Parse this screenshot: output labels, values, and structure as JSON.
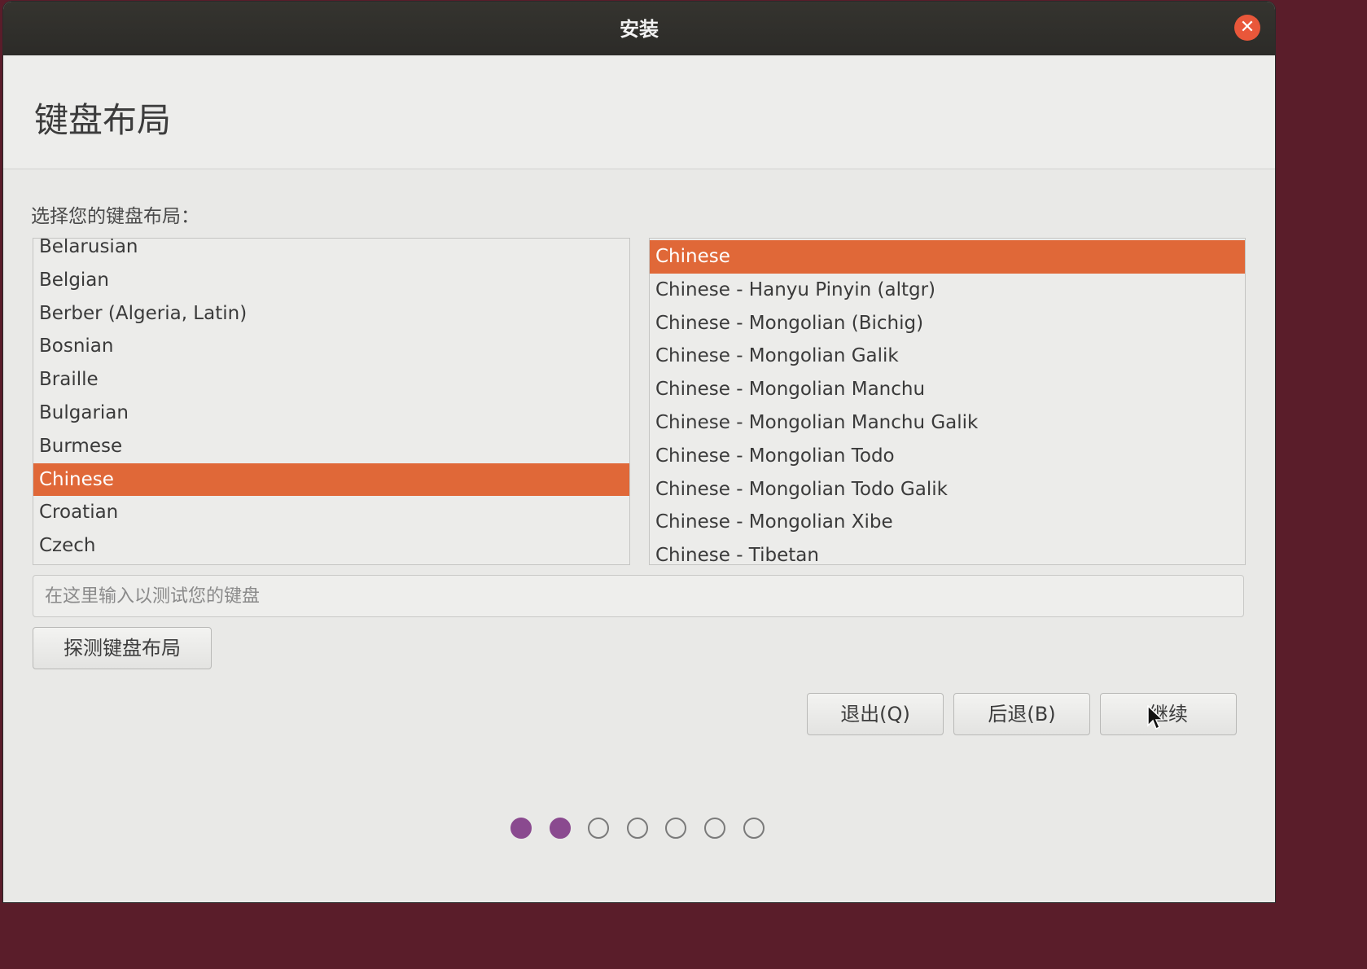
{
  "window": {
    "title": "安装",
    "close_glyph": "✕"
  },
  "page": {
    "title": "键盘布局",
    "prompt": "选择您的键盘布局："
  },
  "layouts": {
    "items": [
      "Belarusian",
      "Belgian",
      "Berber (Algeria, Latin)",
      "Bosnian",
      "Braille",
      "Bulgarian",
      "Burmese",
      "Chinese",
      "Croatian",
      "Czech"
    ],
    "selected": "Chinese"
  },
  "variants": {
    "items": [
      "Chinese",
      "Chinese - Hanyu Pinyin (altgr)",
      "Chinese - Mongolian (Bichig)",
      "Chinese - Mongolian Galik",
      "Chinese - Mongolian Manchu",
      "Chinese - Mongolian Manchu Galik",
      "Chinese - Mongolian Todo",
      "Chinese - Mongolian Todo Galik",
      "Chinese - Mongolian Xibe",
      "Chinese - Tibetan"
    ],
    "selected": "Chinese"
  },
  "test_input": {
    "placeholder": "在这里输入以测试您的键盘",
    "value": ""
  },
  "buttons": {
    "detect": "探测键盘布局",
    "quit": "退出(Q)",
    "back": "后退(B)",
    "continue": "继续"
  },
  "progress": {
    "total_steps": 7,
    "completed_steps": 2
  },
  "colors": {
    "accent": "#e06838",
    "progress_dot": "#8a4a8f",
    "titlebar": "#2f2e2a"
  },
  "icons": {
    "close": "close-icon",
    "cursor": "mouse-pointer-icon"
  }
}
